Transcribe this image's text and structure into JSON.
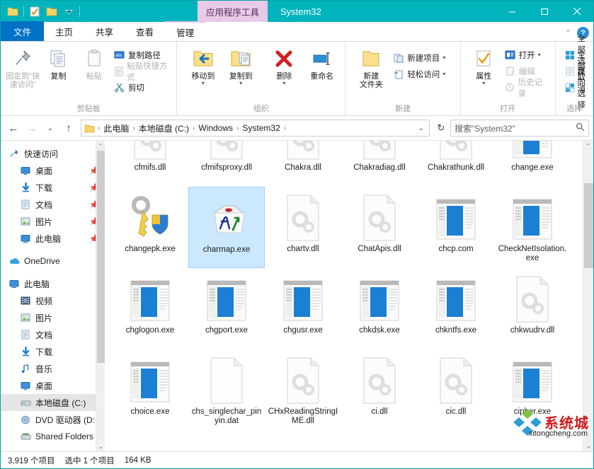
{
  "window": {
    "title": "System32",
    "contextual_tab_title": "应用程序工具",
    "minimize": "—",
    "maximize": "▢",
    "close": "✕"
  },
  "quick_access_toolbar": {
    "items": [
      {
        "name": "folder-icon",
        "glyph": "📁"
      },
      {
        "name": "properties-icon",
        "glyph": "📝"
      },
      {
        "name": "new-folder-icon",
        "glyph": "📁"
      },
      {
        "name": "customize-dropdown-icon",
        "glyph": "▾"
      }
    ]
  },
  "tabs": [
    {
      "id": "file",
      "label": "文件"
    },
    {
      "id": "home",
      "label": "主页"
    },
    {
      "id": "share",
      "label": "共享"
    },
    {
      "id": "view",
      "label": "查看"
    },
    {
      "id": "manage",
      "label": "管理"
    }
  ],
  "ribbon": {
    "collapse_icon": "⌃",
    "help_icon": "?",
    "groups": [
      {
        "label": "剪贴板",
        "big": [
          {
            "label": "固定到\"快\n速访问\"",
            "label_line1": "固定到\"快",
            "label_line2": "速访问\"",
            "icon": "pin-icon",
            "dim": true
          },
          {
            "label": "复制",
            "icon": "copy-icon",
            "dim": false
          },
          {
            "label": "粘贴",
            "icon": "paste-icon",
            "dim": true
          }
        ],
        "small": [
          {
            "label": "复制路径",
            "icon": "copy-path-icon",
            "dim": false
          },
          {
            "label": "粘贴快捷方式",
            "icon": "paste-shortcut-icon",
            "dim": true
          },
          {
            "label": "剪切",
            "icon": "cut-icon",
            "dim": false
          }
        ]
      },
      {
        "label": "组织",
        "big": [
          {
            "label": "移动到",
            "icon": "move-to-icon",
            "caret": true
          },
          {
            "label": "复制到",
            "icon": "copy-to-icon",
            "caret": true
          },
          {
            "label": "删除",
            "icon": "delete-icon",
            "caret": true
          },
          {
            "label": "重命名",
            "icon": "rename-icon",
            "caret": false
          }
        ],
        "small": []
      },
      {
        "label": "新建",
        "big": [
          {
            "label": "新建\n文件夹",
            "label_line1": "新建",
            "label_line2": "文件夹",
            "icon": "new-folder-icon"
          }
        ],
        "small": [
          {
            "label": "新建项目",
            "icon": "new-item-icon",
            "caret": true
          },
          {
            "label": "轻松访问",
            "icon": "easy-access-icon",
            "caret": true
          }
        ]
      },
      {
        "label": "打开",
        "big": [
          {
            "label": "属性",
            "icon": "properties-icon",
            "caret": true
          }
        ],
        "small": [
          {
            "label": "打开",
            "icon": "open-icon",
            "caret": true,
            "dim": false
          },
          {
            "label": "编辑",
            "icon": "edit-icon",
            "dim": true
          },
          {
            "label": "历史记录",
            "icon": "history-icon",
            "dim": true
          }
        ]
      },
      {
        "label": "选择",
        "big": [],
        "small": [
          {
            "label": "全部选择",
            "icon": "select-all-icon"
          },
          {
            "label": "全部取消",
            "icon": "select-none-icon"
          },
          {
            "label": "反向选择",
            "icon": "invert-selection-icon"
          }
        ]
      }
    ]
  },
  "addressbar": {
    "back_icon": "←",
    "forward_icon": "→",
    "recent_icon": "⌄",
    "up_icon": "↑",
    "refresh_icon": "↻",
    "dropdown_icon": "⌄",
    "crumbs": [
      "此电脑",
      "本地磁盘 (C:)",
      "Windows",
      "System32"
    ],
    "separator": "›"
  },
  "search": {
    "placeholder": "搜索\"System32\"",
    "icon": "search-icon"
  },
  "navpane": {
    "sections": [
      {
        "header": {
          "label": "快速访问",
          "icon": "pin-icon"
        },
        "items": [
          {
            "label": "桌面",
            "icon": "desktop-icon",
            "pinned": true
          },
          {
            "label": "下载",
            "icon": "download-icon",
            "pinned": true
          },
          {
            "label": "文档",
            "icon": "documents-icon",
            "pinned": true
          },
          {
            "label": "图片",
            "icon": "pictures-icon",
            "pinned": true
          },
          {
            "label": "此电脑",
            "icon": "this-pc-icon",
            "pinned": true
          }
        ]
      },
      {
        "header": {
          "label": "OneDrive",
          "icon": "onedrive-icon"
        },
        "items": []
      },
      {
        "header": {
          "label": "此电脑",
          "icon": "this-pc-icon"
        },
        "items": [
          {
            "label": "视频",
            "icon": "videos-icon",
            "pinned": false
          },
          {
            "label": "图片",
            "icon": "pictures-icon",
            "pinned": false
          },
          {
            "label": "文档",
            "icon": "documents-icon",
            "pinned": false
          },
          {
            "label": "下载",
            "icon": "download-icon",
            "pinned": false
          },
          {
            "label": "音乐",
            "icon": "music-icon",
            "pinned": false
          },
          {
            "label": "桌面",
            "icon": "desktop-icon",
            "pinned": false
          },
          {
            "label": "本地磁盘 (C:)",
            "icon": "drive-icon",
            "pinned": false,
            "selected": true
          },
          {
            "label": "DVD 驱动器 (D:",
            "icon": "dvd-icon",
            "pinned": false
          },
          {
            "label": "Shared Folders",
            "icon": "network-drive-icon",
            "pinned": false
          }
        ]
      }
    ],
    "scrollbar": {
      "up": "⌃",
      "down": "⌄"
    }
  },
  "files": {
    "scrollbar": {
      "up": "⌃",
      "down": "⌄"
    },
    "items": [
      {
        "name": "cfmifs.dll",
        "icon": "gear-doc-icon",
        "selected": false,
        "clipped_top": true
      },
      {
        "name": "cfmifsproxy.dll",
        "icon": "gear-doc-icon",
        "selected": false,
        "clipped_top": true
      },
      {
        "name": "Chakra.dll",
        "icon": "gear-doc-icon",
        "selected": false,
        "clipped_top": true
      },
      {
        "name": "Chakradiag.dll",
        "icon": "gear-doc-icon",
        "selected": false,
        "clipped_top": true
      },
      {
        "name": "Chakrathunk.dll",
        "icon": "gear-doc-icon",
        "selected": false,
        "clipped_top": true
      },
      {
        "name": "change.exe",
        "icon": "app-window-icon",
        "selected": false,
        "clipped_top": true
      },
      {
        "name": "changepk.exe",
        "icon": "key-shield-icon",
        "selected": false
      },
      {
        "name": "charmap.exe",
        "icon": "charmap-icon",
        "selected": true
      },
      {
        "name": "chartv.dll",
        "icon": "gear-doc-icon",
        "selected": false
      },
      {
        "name": "ChatApis.dll",
        "icon": "gear-doc-icon",
        "selected": false
      },
      {
        "name": "chcp.com",
        "icon": "app-window-icon",
        "selected": false
      },
      {
        "name": "CheckNetIsolation.exe",
        "icon": "app-window-icon",
        "selected": false
      },
      {
        "name": "chglogon.exe",
        "icon": "app-window-icon",
        "selected": false
      },
      {
        "name": "chgport.exe",
        "icon": "app-window-icon",
        "selected": false
      },
      {
        "name": "chgusr.exe",
        "icon": "app-window-icon",
        "selected": false
      },
      {
        "name": "chkdsk.exe",
        "icon": "app-window-icon",
        "selected": false
      },
      {
        "name": "chkntfs.exe",
        "icon": "app-window-icon",
        "selected": false
      },
      {
        "name": "chkwudrv.dll",
        "icon": "gear-doc-icon",
        "selected": false
      },
      {
        "name": "choice.exe",
        "icon": "app-window-icon",
        "selected": false
      },
      {
        "name": "chs_singlechar_pinyin.dat",
        "icon": "blank-doc-icon",
        "selected": false
      },
      {
        "name": "CHxReadingStringIME.dll",
        "icon": "gear-doc-icon",
        "selected": false
      },
      {
        "name": "ci.dll",
        "icon": "gear-doc-icon",
        "selected": false
      },
      {
        "name": "cic.dll",
        "icon": "gear-doc-icon",
        "selected": false
      },
      {
        "name": "cipher.exe",
        "icon": "app-window-icon",
        "selected": false
      }
    ]
  },
  "statusbar": {
    "item_count": "3,919 个项目",
    "selection": "选中 1 个项目",
    "size": "164 KB"
  },
  "watermark": {
    "text_cn": "系统城",
    "text_en": "xitongcheng.com"
  },
  "colors": {
    "titlebar": "#00b3bd",
    "file_tab": "#0072c6",
    "contextual_tab": "#e8c9e8",
    "selection": "#cce8ff",
    "accent_blue": "#1a7fd4"
  }
}
